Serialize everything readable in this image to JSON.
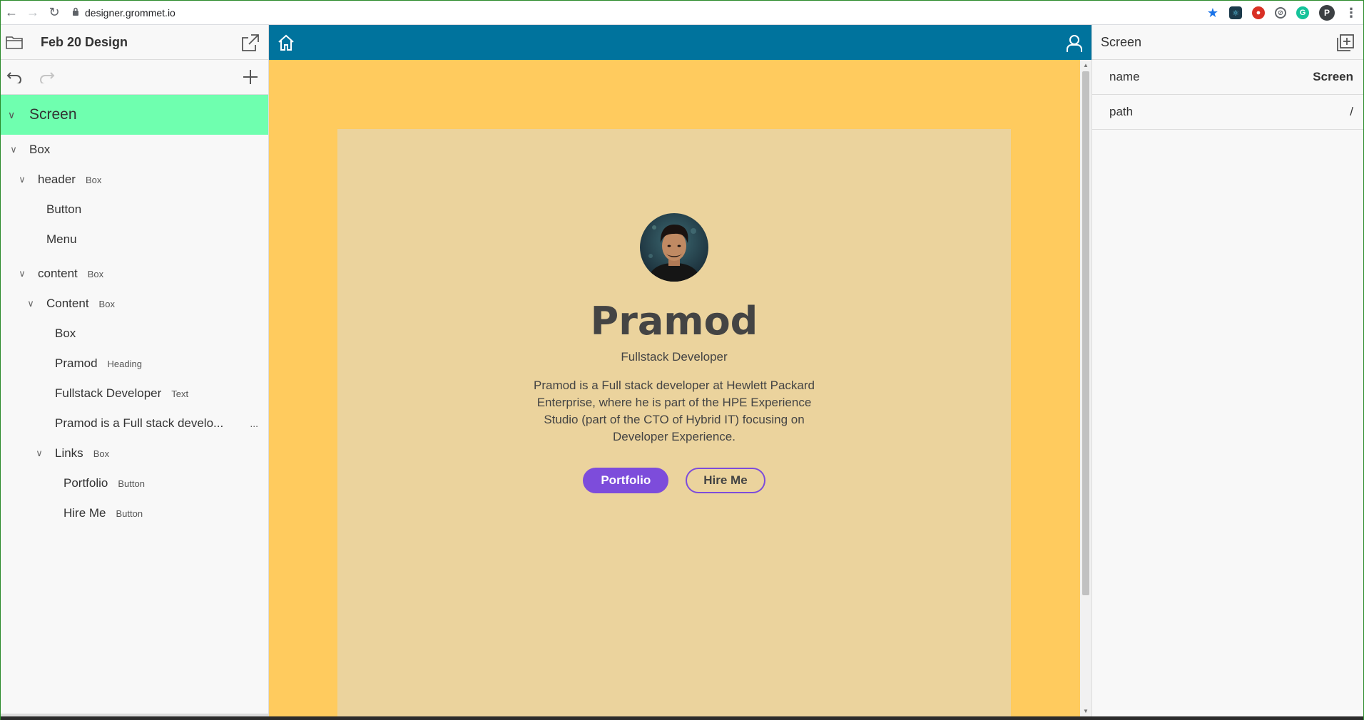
{
  "browser": {
    "url": "designer.grommet.io",
    "profile_initial": "P"
  },
  "left_panel": {
    "design_title": "Feb 20 Design",
    "tree": {
      "root": "Screen",
      "rows": [
        {
          "label": "Box",
          "type": "",
          "indent": 0,
          "chevron": true
        },
        {
          "label": "header",
          "type": "Box",
          "indent": 1,
          "chevron": true
        },
        {
          "label": "Button",
          "type": "",
          "indent": 2,
          "chevron": false
        },
        {
          "label": "Menu",
          "type": "",
          "indent": 2,
          "chevron": false
        },
        {
          "label": "content",
          "type": "Box",
          "indent": 1,
          "chevron": true
        },
        {
          "label": "Content",
          "type": "Box",
          "indent": 2,
          "chevron": true
        },
        {
          "label": "Box",
          "type": "",
          "indent": 3,
          "chevron": false
        },
        {
          "label": "Pramod",
          "type": "Heading",
          "indent": 3,
          "chevron": false
        },
        {
          "label": "Fullstack Developer",
          "type": "Text",
          "indent": 3,
          "chevron": false
        },
        {
          "label": "Pramod is a Full stack develo...",
          "type": "",
          "indent": 3,
          "chevron": false,
          "more": "..."
        },
        {
          "label": "Links",
          "type": "Box",
          "indent": 3,
          "chevron": true
        },
        {
          "label": "Portfolio",
          "type": "Button",
          "indent": 4,
          "chevron": false
        },
        {
          "label": "Hire Me",
          "type": "Button",
          "indent": 4,
          "chevron": false
        }
      ]
    }
  },
  "canvas": {
    "header_color": "#00739d",
    "background_color": "#ffcb5e",
    "content_color": "#ebd39d",
    "profile": {
      "name": "Pramod",
      "role": "Fullstack Developer",
      "bio": "Pramod is a Full stack developer at Hewlett Packard Enterprise, where he is part of the HPE Experience Studio (part of the CTO of Hybrid IT) focusing on Developer Experience.",
      "buttons": {
        "primary": "Portfolio",
        "secondary": "Hire Me"
      },
      "accent_color": "#7d4cdb"
    }
  },
  "right_panel": {
    "title": "Screen",
    "properties": [
      {
        "name": "name",
        "value": "Screen"
      },
      {
        "name": "path",
        "value": "/"
      }
    ]
  }
}
